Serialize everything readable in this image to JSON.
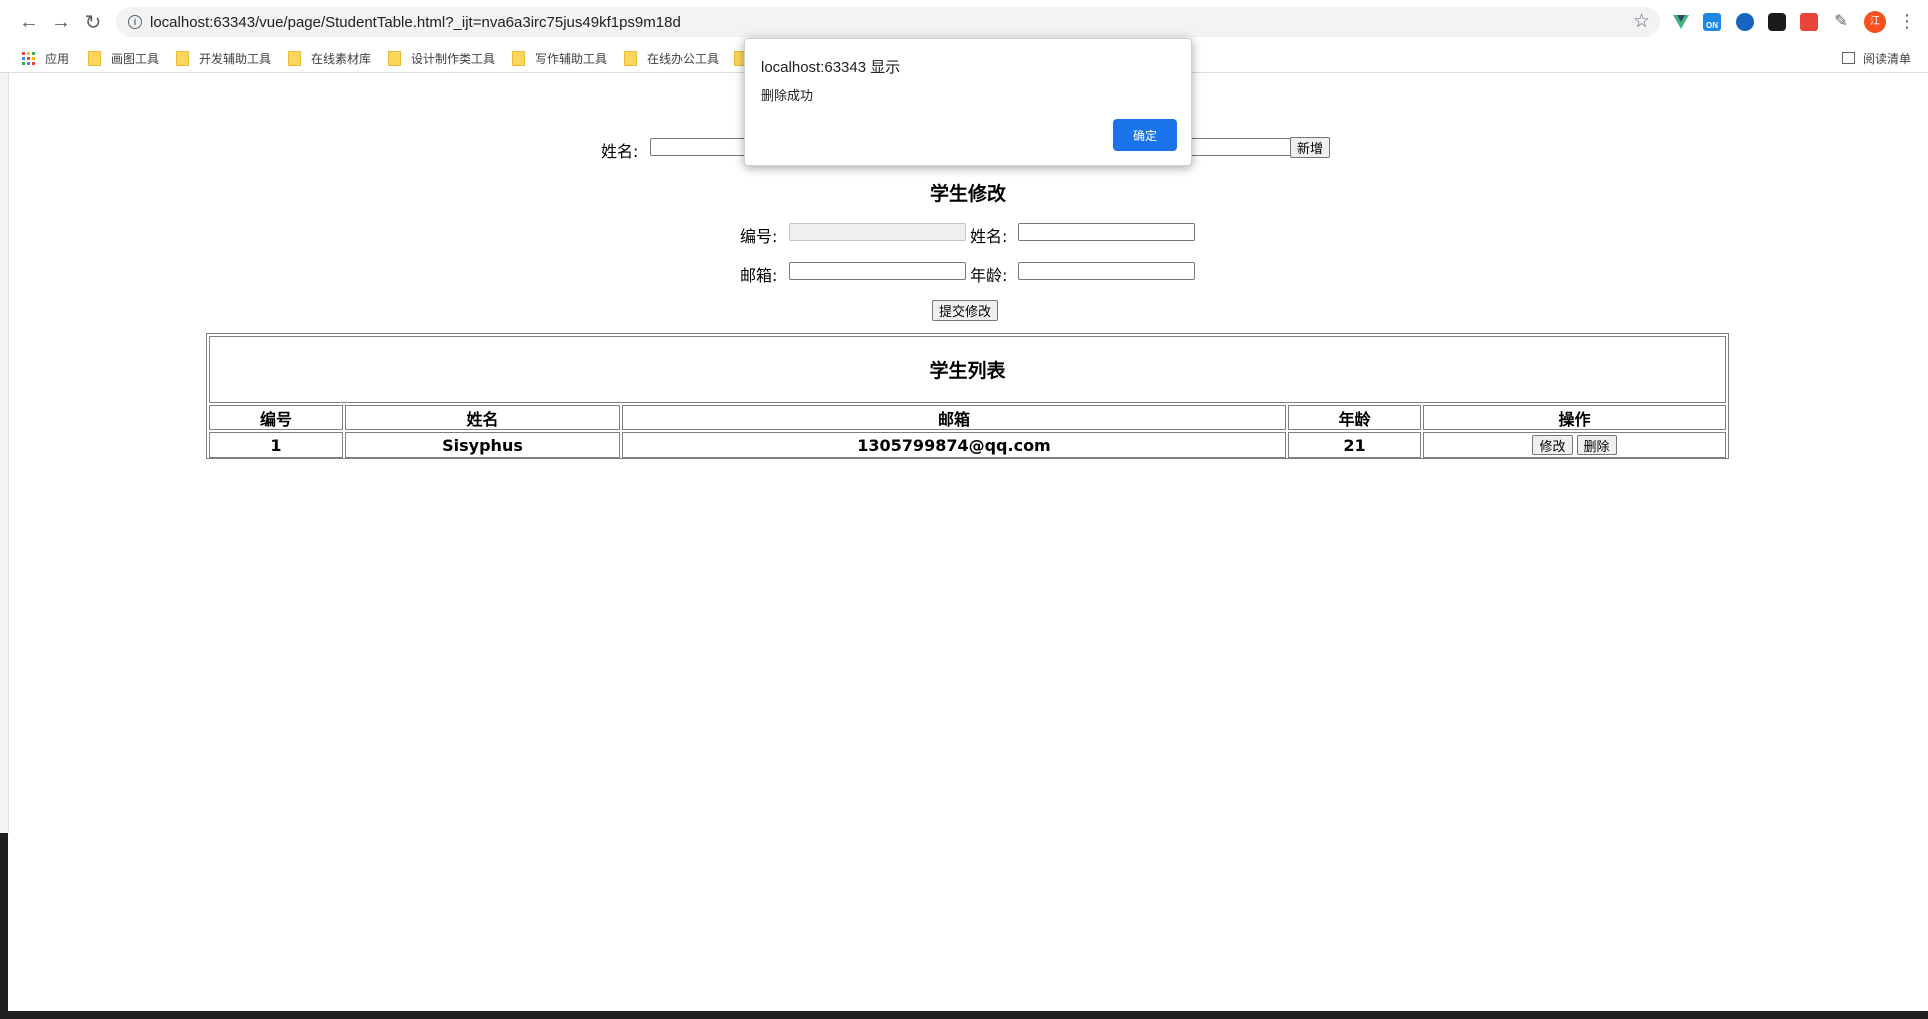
{
  "browser": {
    "url": "localhost:63343/vue/page/StudentTable.html?_ijt=nva6a3irc75jus49kf1ps9m18d",
    "bookmarks": [
      {
        "label": "应用"
      },
      {
        "label": "画图工具"
      },
      {
        "label": "开发辅助工具"
      },
      {
        "label": "在线素材库"
      },
      {
        "label": "设计制作类工具"
      },
      {
        "label": "写作辅助工具"
      },
      {
        "label": "在线办公工具"
      }
    ],
    "reading_list": "阅读清单",
    "extension_badge": "ON",
    "profile_initial": "江",
    "colors": {
      "accent": "#1a73e8",
      "omnibox_bg": "#f1f3f4"
    }
  },
  "add_form": {
    "name_label": "姓名:",
    "add_button": "新增"
  },
  "edit_form": {
    "title": "学生修改",
    "id_label": "编号:",
    "name_label": "姓名:",
    "email_label": "邮箱:",
    "age_label": "年龄:",
    "submit_button": "提交修改"
  },
  "table": {
    "title": "学生列表",
    "headers": [
      "编号",
      "姓名",
      "邮箱",
      "年龄",
      "操作"
    ],
    "rows": [
      {
        "id": "1",
        "name": "Sisyphus",
        "email": "1305799874@qq.com",
        "age": "21",
        "edit": "修改",
        "delete": "删除"
      }
    ]
  },
  "alert": {
    "title": "localhost:63343 显示",
    "message": "删除成功",
    "ok_button": "确定"
  }
}
